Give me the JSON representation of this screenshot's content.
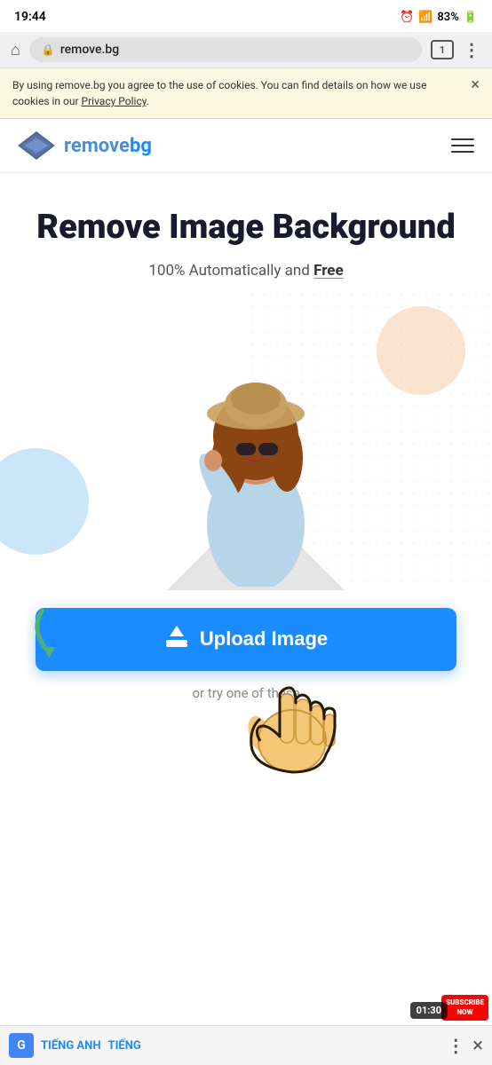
{
  "statusBar": {
    "time": "19:44",
    "battery": "83%",
    "wifiSignal": "WiFi",
    "cellSignal": "4G"
  },
  "browserBar": {
    "url": "remove.bg",
    "tabCount": "1",
    "homeLabel": "⌂",
    "moreLabel": "⋮"
  },
  "cookieBanner": {
    "text": "By using remove.bg you agree to the use of cookies. You can find details on how we use cookies in our ",
    "linkText": "Privacy Policy",
    "closeLabel": "×"
  },
  "nav": {
    "logoTextDark": "remove",
    "logoTextBlue": "bg",
    "hamburgerLabel": "Menu"
  },
  "hero": {
    "title": "Remove Image Background",
    "subtitle": "100% Automatically and ",
    "subtitleBold": "Free"
  },
  "uploadArea": {
    "buttonLabel": "Upload Image",
    "orText": "or try one of these"
  },
  "bottomBar": {
    "translateLabel": "G",
    "lang1": "TIẾNG ANH",
    "lang2": "TIẾNG",
    "moreLabel": "⋮",
    "closeLabel": "×"
  },
  "subscribeBadge": {
    "line1": "SUBSCRIBE",
    "line2": "NOW"
  },
  "timerBadge": {
    "time": "01:30"
  }
}
